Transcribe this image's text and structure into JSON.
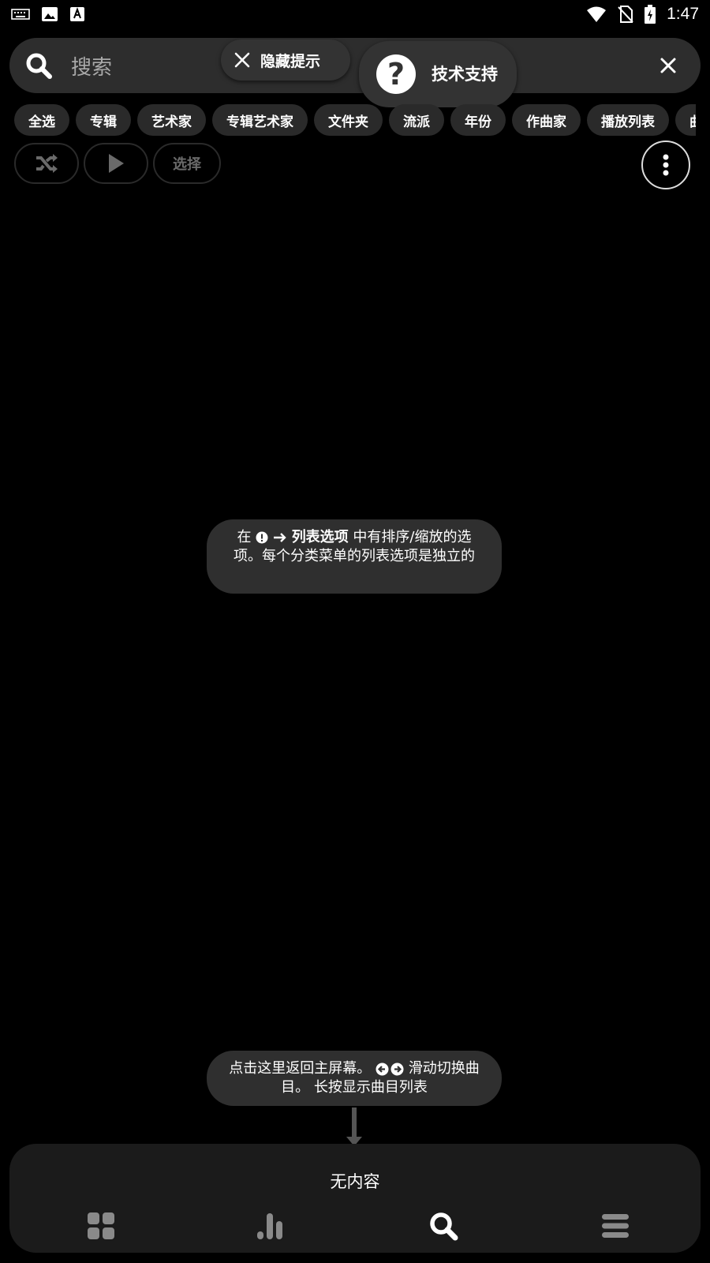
{
  "status_bar": {
    "time": "1:47"
  },
  "search": {
    "placeholder": "搜索"
  },
  "hints": {
    "hide_label": "隐藏提示",
    "support_label": "技术支持"
  },
  "chips": [
    "全选",
    "专辑",
    "艺术家",
    "专辑艺术家",
    "文件夹",
    "流派",
    "年份",
    "作曲家",
    "播放列表",
    "曲"
  ],
  "actions": {
    "select_label": "选择"
  },
  "tip_list": {
    "prefix": "在",
    "bold": "列表选项",
    "rest": "中有排序/缩放的选项。每个分类菜单的列表选项是独立的"
  },
  "tip_home": {
    "part1": "点击这里返回主屏幕。",
    "part2": "滑动切换曲目。 长按显示曲目列表"
  },
  "bottom": {
    "now_playing": "无内容"
  },
  "colors": {
    "background": "#000000",
    "pill": "#2f2f2f",
    "panel": "#1b1b1b",
    "nav_inactive": "#8a8a8a"
  }
}
